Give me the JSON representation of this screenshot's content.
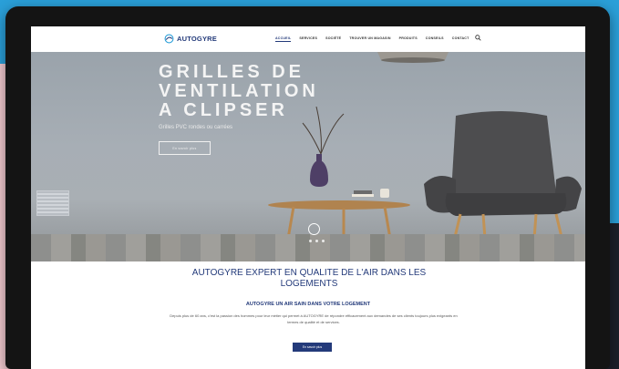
{
  "header": {
    "logo_text": "AUTOGYRE",
    "menu": [
      {
        "label": "ACCUEIL",
        "active": true
      },
      {
        "label": "SERVICES",
        "active": false
      },
      {
        "label": "SOCIÉTÉ",
        "active": false
      },
      {
        "label": "TROUVER UN MAGASIN",
        "active": false
      },
      {
        "label": "PRODUITS",
        "active": false
      },
      {
        "label": "CONSEILS",
        "active": false
      },
      {
        "label": "CONTACT",
        "active": false
      }
    ],
    "search_icon": "search-icon"
  },
  "hero": {
    "title_lines": [
      "GRILLES DE",
      "VENTILATION",
      "A CLIPSER"
    ],
    "subtitle": "Grilles PVC rondes ou carrées",
    "button_label": "En savoir plus"
  },
  "main": {
    "heading": "AUTOGYRE EXPERT EN QUALITE DE L'AIR DANS  LES LOGEMENTS",
    "subheading": "AUTOGYRE UN AIR SAIN DANS VOTRE LOGEMENT",
    "paragraph": "Depuis plus de 60 ans, c'est la passion des hommes pour leur métier qui permet à AUTOGYRE de répondre efficacement aux demandes de ses clients toujours plus exigeants en termes de qualité et de services.",
    "button_label": "En savoir plus"
  },
  "colors": {
    "brand": "#233a7a",
    "background": "#2a9fd8",
    "accent_pink": "#f1c9cf"
  }
}
